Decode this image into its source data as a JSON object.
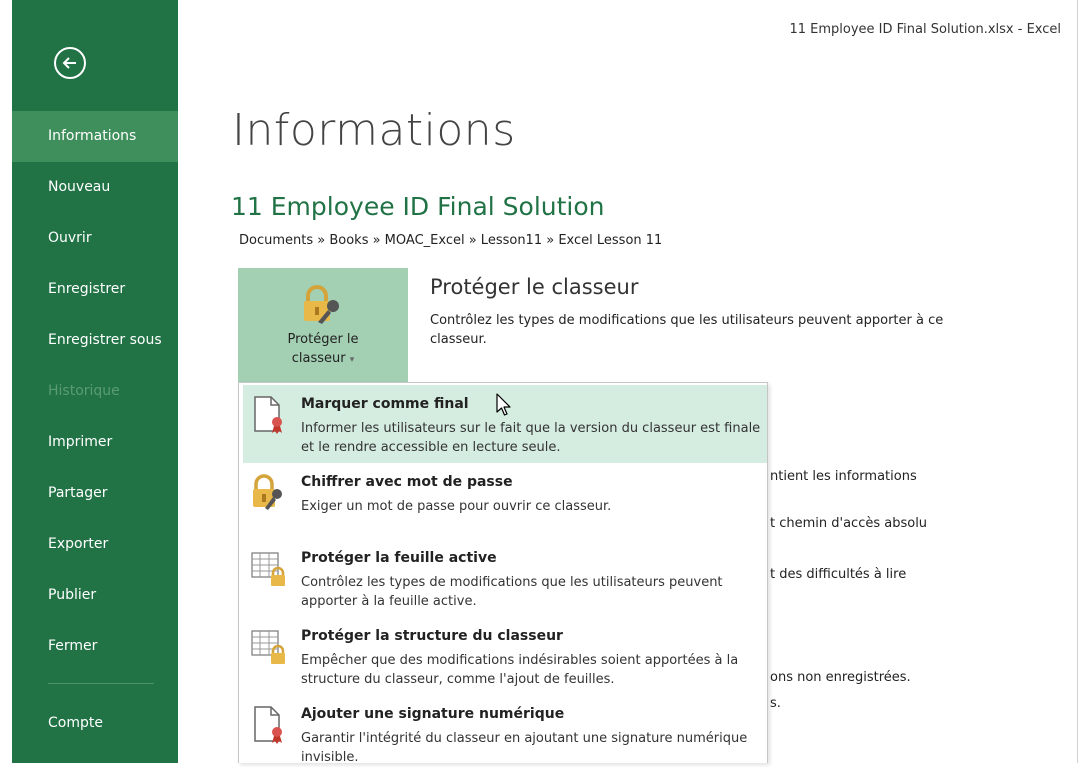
{
  "window_title": "11 Employee ID Final Solution.xlsx - Excel",
  "sidebar": {
    "items": [
      {
        "label": "Informations",
        "active": true
      },
      {
        "label": "Nouveau"
      },
      {
        "label": "Ouvrir"
      },
      {
        "label": "Enregistrer"
      },
      {
        "label": "Enregistrer sous"
      },
      {
        "label": "Historique",
        "disabled": true
      },
      {
        "label": "Imprimer"
      },
      {
        "label": "Partager"
      },
      {
        "label": "Exporter"
      },
      {
        "label": "Publier"
      },
      {
        "label": "Fermer"
      }
    ],
    "bottom_label": "Compte"
  },
  "main": {
    "title": "Informations",
    "file_name": "11 Employee ID Final Solution",
    "breadcrumb": "Documents » Books » MOAC_Excel » Lesson11 » Excel Lesson 11",
    "protect_tile": {
      "line1": "Protéger le",
      "line2": "classeur"
    },
    "protect_heading": "Protéger le classeur",
    "protect_desc": "Contrôlez les types de modifications que les utilisateurs peuvent apporter à ce classeur.",
    "background_fragments": [
      "ntient les informations",
      "t chemin d'accès absolu",
      "t des difficultés à lire",
      "ons non enregistrées.",
      "s."
    ]
  },
  "menu": {
    "items": [
      {
        "title": "Marquer comme final",
        "desc": "Informer les utilisateurs sur le fait que la version du classeur est finale et le rendre accessible en lecture seule."
      },
      {
        "title": "Chiffrer avec mot de passe",
        "desc": "Exiger un mot de passe pour ouvrir ce classeur."
      },
      {
        "title": "Protéger la feuille active",
        "desc": "Contrôlez les types de modifications que les utilisateurs peuvent apporter à la feuille active."
      },
      {
        "title": "Protéger la structure du classeur",
        "desc": "Empêcher que des modifications indésirables soient apportées à la structure du classeur, comme l'ajout de feuilles."
      },
      {
        "title": "Ajouter une signature numérique",
        "desc": "Garantir l'intégrité du classeur en ajoutant une signature numérique invisible."
      }
    ]
  },
  "colors": {
    "accent": "#217346",
    "sidebar_active": "#3e8f5b",
    "tile": "#a3cfb3",
    "menu_hover": "#d5ece0"
  },
  "icons": [
    "back-arrow-icon",
    "lock-key-icon",
    "document-ribbon-icon",
    "sheet-lock-icon",
    "mouse-cursor-icon"
  ]
}
